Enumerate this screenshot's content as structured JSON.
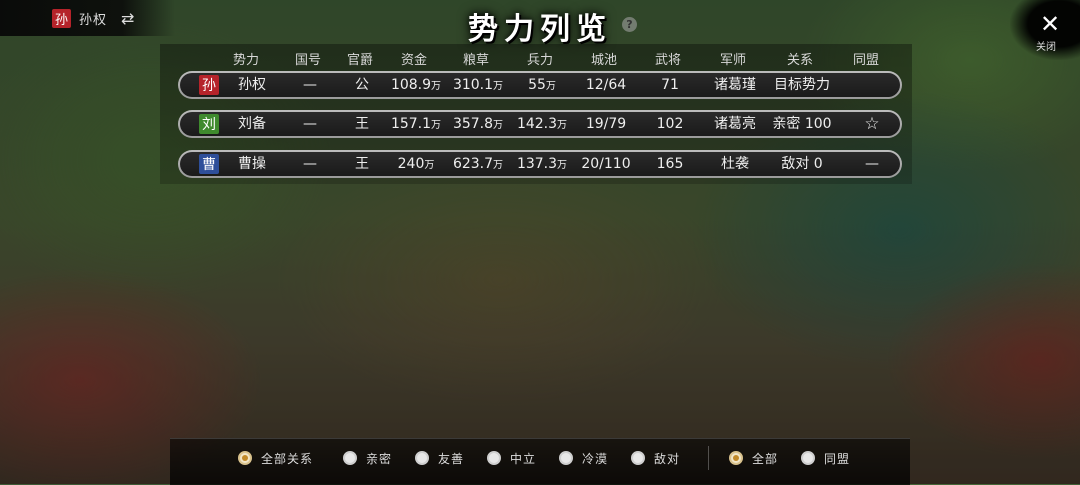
{
  "player": {
    "seal": "孙",
    "name": "孙权",
    "switch_icon": "⇄"
  },
  "title": "势力列览",
  "help_icon": "?",
  "close": {
    "icon": "✕",
    "label": "关闭"
  },
  "headers": [
    "势力",
    "国号",
    "官爵",
    "资金",
    "粮草",
    "兵力",
    "城池",
    "武将",
    "军师",
    "关系",
    "同盟"
  ],
  "rows": [
    {
      "seal": "孙",
      "seal_color": "#b5232a",
      "name": "孙权",
      "guohao": "—",
      "guanjue": "公",
      "funds": "108.9",
      "funds_unit": "万",
      "grain": "310.1",
      "grain_unit": "万",
      "troops": "55",
      "troops_unit": "万",
      "cities": "12/64",
      "generals": "71",
      "strategist": "诸葛瑾",
      "relation": "目标势力",
      "alliance": ""
    },
    {
      "seal": "刘",
      "seal_color": "#3f8a2e",
      "name": "刘备",
      "guohao": "—",
      "guanjue": "王",
      "funds": "157.1",
      "funds_unit": "万",
      "grain": "357.8",
      "grain_unit": "万",
      "troops": "142.3",
      "troops_unit": "万",
      "cities": "19/79",
      "generals": "102",
      "strategist": "诸葛亮",
      "relation": "亲密 100",
      "alliance": "☆"
    },
    {
      "seal": "曹",
      "seal_color": "#2e4f9a",
      "name": "曹操",
      "guohao": "—",
      "guanjue": "王",
      "funds": "240",
      "funds_unit": "万",
      "grain": "623.7",
      "grain_unit": "万",
      "troops": "137.3",
      "troops_unit": "万",
      "cities": "20/110",
      "generals": "165",
      "strategist": "杜袭",
      "relation": "敌对 0",
      "alliance": "—"
    }
  ],
  "filters": {
    "relations": [
      {
        "label": "全部关系",
        "selected": true
      },
      {
        "label": "亲密",
        "selected": false
      },
      {
        "label": "友善",
        "selected": false
      },
      {
        "label": "中立",
        "selected": false
      },
      {
        "label": "冷漠",
        "selected": false
      },
      {
        "label": "敌对",
        "selected": false
      }
    ],
    "alliance": [
      {
        "label": "全部",
        "selected": true
      },
      {
        "label": "同盟",
        "selected": false
      }
    ]
  }
}
